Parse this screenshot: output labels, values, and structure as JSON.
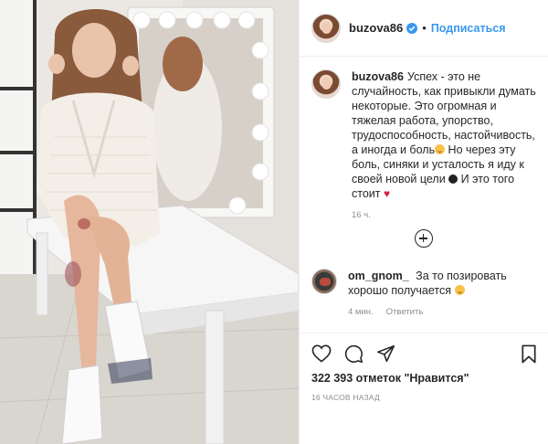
{
  "post": {
    "username": "buzova86",
    "follow_label": "Подписаться",
    "dot": "•",
    "caption_author": "buzova86",
    "caption_text": "Успех - это не случайность, как привыкли думать некоторые. Это огромная и тяжелая работа, упорство, трудоспособность, настойчивость, а иногда и боль",
    "caption_text_2": " Но через эту боль, синяки и усталость я иду к своей новой цели",
    "caption_text_3": " И это того стоит",
    "caption_time": "16 ч.",
    "comment": {
      "author": "om_gnom_",
      "text": "За то позировать хорошо получается",
      "time": "4 мин.",
      "reply_label": "Ответить"
    },
    "likes_text": "322 393 отметок \"Нравится\"",
    "timestamp": "16 ЧАСОВ НАЗАД"
  },
  "icons": {
    "verified": "verified-badge-icon",
    "like": "heart-icon",
    "comment": "comment-icon",
    "share": "share-icon",
    "save": "bookmark-icon",
    "load_more": "plus-circle-icon"
  },
  "colors": {
    "link": "#3897f0",
    "text": "#262626",
    "secondary": "#8e8e8e",
    "border": "#efefef",
    "heart": "#d3213a"
  }
}
